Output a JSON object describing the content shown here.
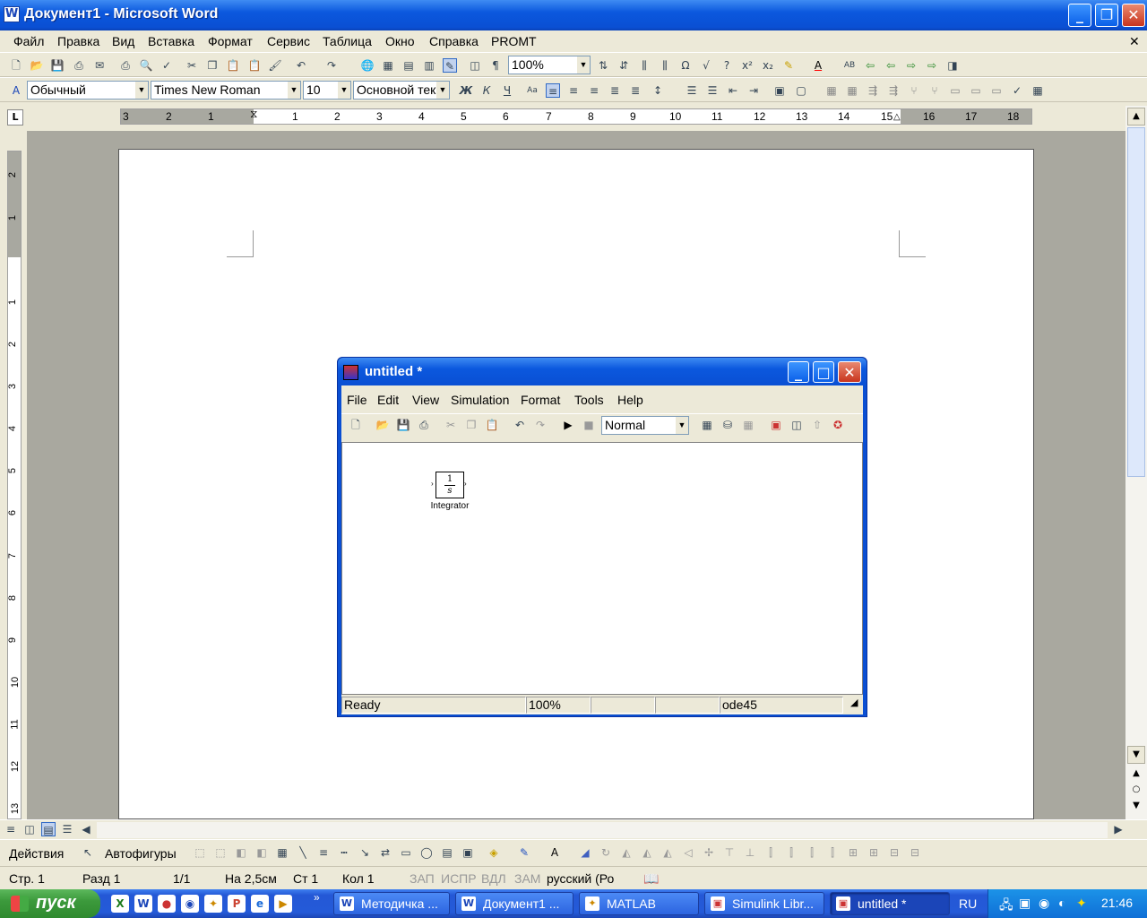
{
  "word": {
    "title": "Документ1 - Microsoft Word",
    "menu": [
      "Файл",
      "Правка",
      "Вид",
      "Вставка",
      "Формат",
      "Сервис",
      "Таблица",
      "Окно",
      "Справка",
      "PROMT"
    ],
    "zoom": "100%",
    "style": "Обычный",
    "font": "Times New Roman",
    "size": "10",
    "style2": "Основной тек",
    "format_buttons": {
      "bold": "Ж",
      "italic": "К",
      "underline": "Ч"
    },
    "ruler_labels": [
      "3",
      "2",
      "1",
      "1",
      "2",
      "3",
      "4",
      "5",
      "6",
      "7",
      "8",
      "9",
      "10",
      "11",
      "12",
      "13",
      "14",
      "15",
      "16",
      "17",
      "18"
    ],
    "vruler_labels": [
      "2",
      "1",
      "1",
      "2",
      "3",
      "4",
      "5",
      "6",
      "7",
      "8",
      "9",
      "10",
      "11",
      "12",
      "13"
    ],
    "draw": {
      "actions": "Действия",
      "autoshapes": "Автофигуры"
    },
    "status": {
      "page": "Стр. 1",
      "section": "Разд 1",
      "pages": "1/1",
      "at": "На 2,5см",
      "line": "Ст 1",
      "col": "Кол 1",
      "rec": "ЗАП",
      "trk": "ИСПР",
      "ext": "ВДЛ",
      "ovr": "ЗАМ",
      "lang": "русский (Ро"
    }
  },
  "simulink": {
    "title": "untitled *",
    "menu": [
      "File",
      "Edit",
      "View",
      "Simulation",
      "Format",
      "Tools",
      "Help"
    ],
    "mode": "Normal",
    "block": {
      "num": "1",
      "den": "s",
      "label": "Integrator"
    },
    "status": {
      "state": "Ready",
      "zoom": "100%",
      "solver": "ode45"
    }
  },
  "taskbar": {
    "start": "пуск",
    "tasks": [
      "Методичка ...",
      "Документ1 ...",
      "MATLAB",
      "Simulink Libr...",
      "untitled *"
    ],
    "lang": "RU",
    "time": "21:46"
  }
}
